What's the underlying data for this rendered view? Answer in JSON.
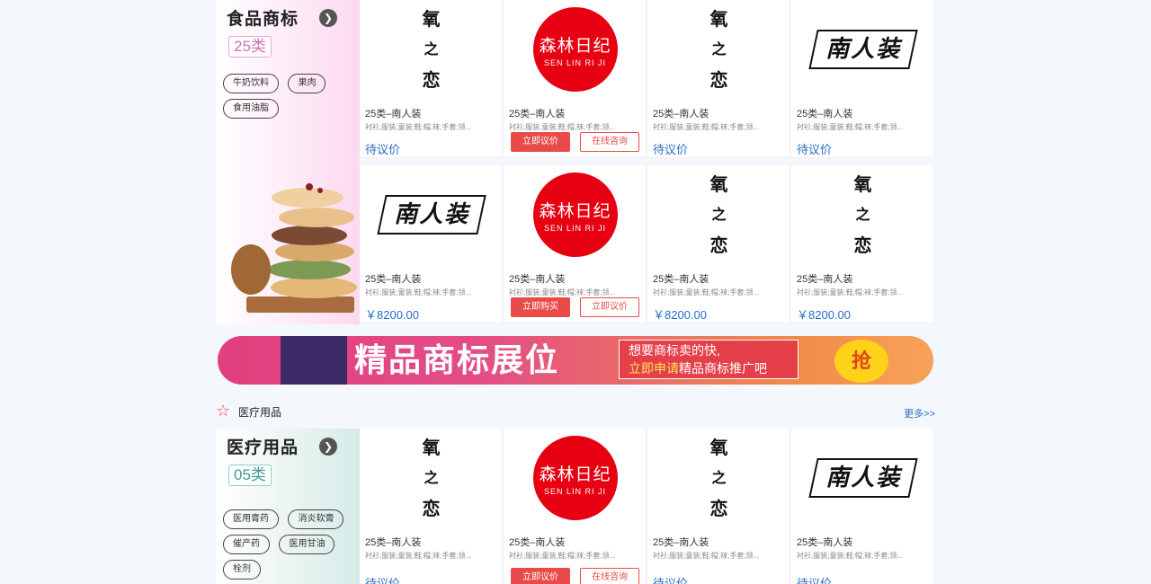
{
  "food": {
    "title": "食品商标",
    "class": "25类",
    "tags": [
      "牛奶饮料",
      "果肉",
      "食用油脂"
    ]
  },
  "medical": {
    "section_title": "医疗用品",
    "more": "更多>>",
    "title": "医疗用品",
    "class": "05类",
    "tags": [
      "医用膏药",
      "消炎软膏",
      "催产药",
      "医用甘油",
      "栓剂"
    ]
  },
  "logos": {
    "yang": [
      "氧",
      "之",
      "恋"
    ],
    "sen_cn": "森林日纪",
    "sen_en": "SEN LIN RI JI",
    "nrz": "南人装"
  },
  "card_name": "25类–南人装",
  "goods": "衬衫;服装;童装;鞋;帽;袜;手套;领...",
  "price_negotiable": "待议价",
  "price_value": "￥8200.00",
  "buttons": {
    "negotiate": "立即议价",
    "consult": "在线咨询",
    "buy": "立即购买",
    "negotiate2": "立即议价"
  },
  "banner": {
    "headline": "精品商标展位",
    "line1": "想要商标卖的快,",
    "line2_highlight": "立即申请",
    "line2_rest": "精品商标推广吧",
    "grab": "抢"
  }
}
